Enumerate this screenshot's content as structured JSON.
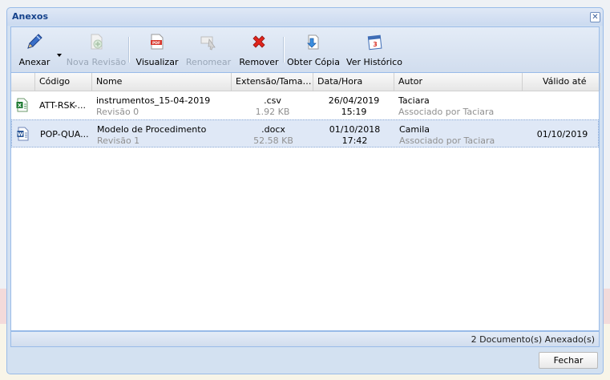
{
  "window": {
    "title": "Anexos"
  },
  "toolbar": {
    "buttons": [
      {
        "label": "Anexar",
        "icon": "pencil-icon",
        "enabled": true
      },
      {
        "label": "Nova Revisão",
        "icon": "new-revision-icon",
        "enabled": false
      },
      {
        "label": "Visualizar",
        "icon": "pdf-icon",
        "enabled": true
      },
      {
        "label": "Renomear",
        "icon": "rename-icon",
        "enabled": false
      },
      {
        "label": "Remover",
        "icon": "remove-x-icon",
        "enabled": true
      },
      {
        "label": "Obter Cópia",
        "icon": "download-icon",
        "enabled": true
      },
      {
        "label": "Ver Histórico",
        "icon": "history-calendar-icon",
        "enabled": true
      }
    ]
  },
  "grid": {
    "columns": [
      "",
      "Código",
      "Nome",
      "Extensão/Taman...",
      "Data/Hora",
      "Autor",
      "Válido até"
    ],
    "rows": [
      {
        "icon": "excel-file-icon",
        "code": "ATT-RSK-...",
        "name": "instrumentos_15-04-2019",
        "revision": "Revisão 0",
        "ext": ".csv",
        "size": "1.92 KB",
        "date": "26/04/2019",
        "time": "15:19",
        "author": "Taciara",
        "assoc": "Associado por Taciara",
        "valid": ""
      },
      {
        "icon": "word-file-icon",
        "code": "POP-QUA...",
        "name": "Modelo de Procedimento",
        "revision": "Revisão 1",
        "ext": ".docx",
        "size": "52.58 KB",
        "date": "01/10/2018",
        "time": "17:42",
        "author": "Camila",
        "assoc": "Associado por Taciara",
        "valid": "01/10/2019"
      }
    ]
  },
  "footer": {
    "count": "2 Documento(s) Anexado(s)"
  },
  "actions": {
    "close_label": "Fechar"
  },
  "colors": {
    "accent": "#15428b",
    "border": "#99bbe8",
    "selected": "#dfe8f6"
  }
}
